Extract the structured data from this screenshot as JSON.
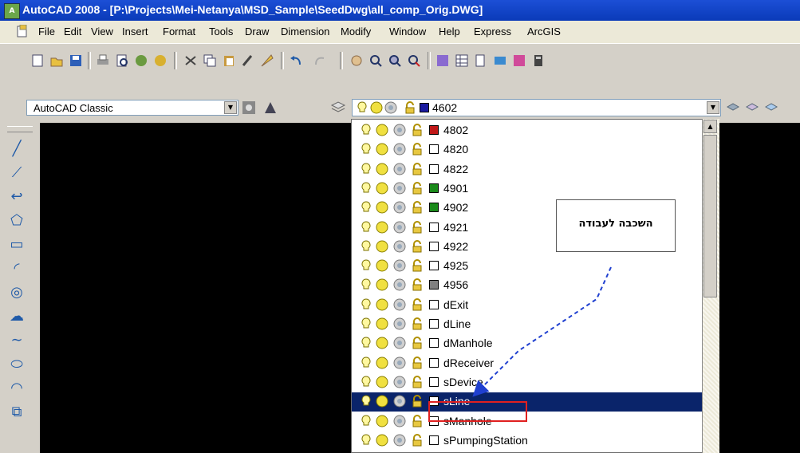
{
  "window": {
    "app_icon_text": "A",
    "title": "AutoCAD 2008 - [P:\\Projects\\Mei-Netanya\\MSD_Sample\\SeedDwg\\all_comp_Orig.DWG]"
  },
  "menu": [
    "File",
    "Edit",
    "View",
    "Insert",
    "Format",
    "Tools",
    "Draw",
    "Dimension",
    "Modify",
    "Window",
    "Help",
    "Express",
    "ArcGIS"
  ],
  "workspace": {
    "value": "AutoCAD Classic"
  },
  "layer_control": {
    "current_layer": "4602",
    "current_color": "#1a1aa0"
  },
  "layers": [
    {
      "name": "4802",
      "color": "#c01818"
    },
    {
      "name": "4820",
      "color": "#ffffff"
    },
    {
      "name": "4822",
      "color": "#ffffff"
    },
    {
      "name": "4901",
      "color": "#1a8a1a"
    },
    {
      "name": "4902",
      "color": "#1a8a1a"
    },
    {
      "name": "4921",
      "color": "#ffffff"
    },
    {
      "name": "4922",
      "color": "#ffffff"
    },
    {
      "name": "4925",
      "color": "#ffffff"
    },
    {
      "name": "4956",
      "color": "#808080"
    },
    {
      "name": "dExit",
      "color": "#ffffff"
    },
    {
      "name": "dLine",
      "color": "#ffffff"
    },
    {
      "name": "dManhole",
      "color": "#ffffff"
    },
    {
      "name": "dReceiver",
      "color": "#ffffff"
    },
    {
      "name": "sDevice",
      "color": "#ffffff"
    },
    {
      "name": "sLine",
      "color": "#ffffff",
      "selected": true
    },
    {
      "name": "sManhole",
      "color": "#ffffff"
    },
    {
      "name": "sPumpingStation",
      "color": "#ffffff"
    }
  ],
  "callout": {
    "text": "השכבה לעבודה"
  },
  "colors": {
    "selection": "#0a246a",
    "highlight": "#e02020",
    "arrow": "#2040d0"
  },
  "icons": [
    "bulb-icon",
    "sun-icon",
    "freeze-icon",
    "lock-icon"
  ]
}
